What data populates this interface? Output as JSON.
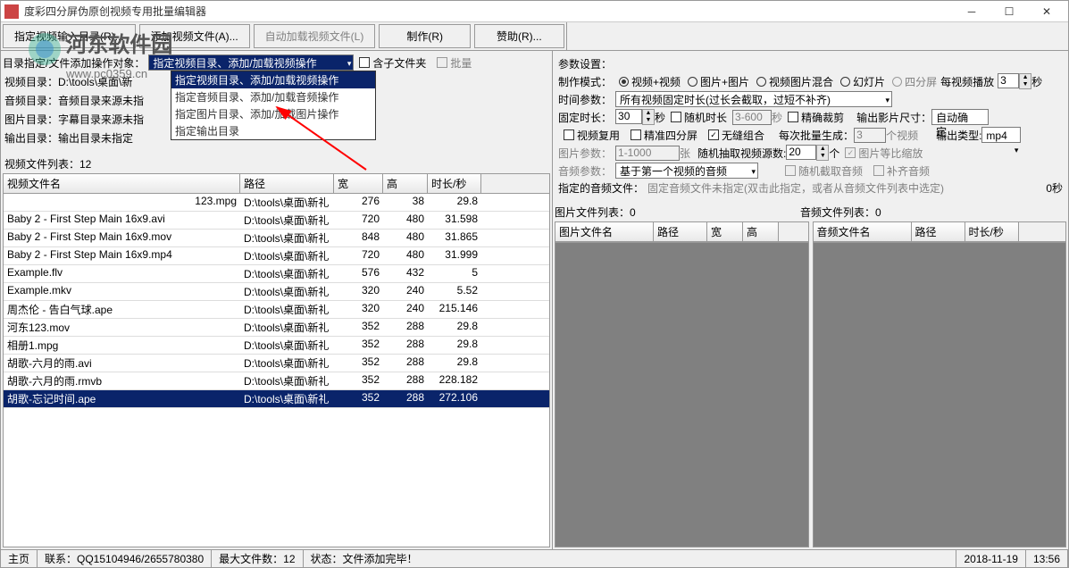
{
  "title": "度彩四分屏伪原创视频专用批量编辑器",
  "toolbar": {
    "btn1": "指定视频输入目录(R)...",
    "btn2": "添加视频文件(A)...",
    "btn3": "自动加载视频文件(L)",
    "btn4": "制作(R)",
    "btn5": "赞助(R)..."
  },
  "left": {
    "combo_label": "目录指定/文件添加操作对象：",
    "combo_value": "指定视频目录、添加/加载视频操作",
    "dd_items": [
      "指定视频目录、添加/加载视频操作",
      "指定音频目录、添加/加载音频操作",
      "指定图片目录、添加/加载图片操作",
      "指定输出目录"
    ],
    "include_sub": "含子文件夹",
    "batch": "批量",
    "dir_video_l": "视频目录：",
    "dir_video_v": "D:\\tools\\桌面\\新",
    "dir_audio_l": "音频目录：",
    "dir_audio_v": "音频目录来源未指",
    "dir_pic_l": "图片目录：",
    "dir_pic_v": "字幕目录来源未指",
    "dir_out_l": "输出目录：",
    "dir_out_v": "输出目录未指定",
    "list_count": "视频文件列表：12",
    "headers": {
      "name": "视频文件名",
      "path": "路径",
      "w": "宽",
      "h": "高",
      "dur": "时长/秒"
    },
    "rows": [
      {
        "name": "123.mpg",
        "path": "D:\\tools\\桌面\\新礼",
        "w": "276",
        "h": "38",
        "dur": "29.8"
      },
      {
        "name": "Baby 2 - First Step Main 16x9.avi",
        "path": "D:\\tools\\桌面\\新礼",
        "w": "720",
        "h": "480",
        "dur": "31.598"
      },
      {
        "name": "Baby 2 - First Step Main 16x9.mov",
        "path": "D:\\tools\\桌面\\新礼",
        "w": "848",
        "h": "480",
        "dur": "31.865"
      },
      {
        "name": "Baby 2 - First Step Main 16x9.mp4",
        "path": "D:\\tools\\桌面\\新礼",
        "w": "720",
        "h": "480",
        "dur": "31.999"
      },
      {
        "name": "Example.flv",
        "path": "D:\\tools\\桌面\\新礼",
        "w": "576",
        "h": "432",
        "dur": "5"
      },
      {
        "name": "Example.mkv",
        "path": "D:\\tools\\桌面\\新礼",
        "w": "320",
        "h": "240",
        "dur": "5.52"
      },
      {
        "name": "周杰伦 - 告白气球.ape",
        "path": "D:\\tools\\桌面\\新礼",
        "w": "320",
        "h": "240",
        "dur": "215.146"
      },
      {
        "name": "河东123.mov",
        "path": "D:\\tools\\桌面\\新礼",
        "w": "352",
        "h": "288",
        "dur": "29.8"
      },
      {
        "name": "相册1.mpg",
        "path": "D:\\tools\\桌面\\新礼",
        "w": "352",
        "h": "288",
        "dur": "29.8"
      },
      {
        "name": "胡歌-六月的雨.avi",
        "path": "D:\\tools\\桌面\\新礼",
        "w": "352",
        "h": "288",
        "dur": "29.8"
      },
      {
        "name": "胡歌-六月的雨.rmvb",
        "path": "D:\\tools\\桌面\\新礼",
        "w": "352",
        "h": "288",
        "dur": "228.182"
      },
      {
        "name": "胡歌-忘记时间.ape",
        "path": "D:\\tools\\桌面\\新礼",
        "w": "352",
        "h": "288",
        "dur": "272.106",
        "sel": true
      }
    ]
  },
  "right": {
    "param_title": "参数设置：",
    "mode_label": "制作模式：",
    "mode_vv": "视频+视频",
    "mode_pp": "图片+图片",
    "mode_vp": "视频图片混合",
    "mode_slide": "幻灯片",
    "mode_quad": "四分屏",
    "per_play": "每视频播放",
    "per_play_val": "3",
    "second": "秒",
    "time_label": "时间参数：",
    "time_combo": "所有视频固定时长(过长会截取，过短不补齐)",
    "fixed_dur": "固定时长：",
    "fixed_dur_val": "30",
    "rand_dur": "随机时长",
    "rand_dur_val": "3-600",
    "precise_cut": "精确裁剪",
    "out_size": "输出影片尺寸：",
    "out_size_val": "自动确定",
    "reuse": "视频复用",
    "precise_quad": "精准四分屏",
    "seamless": "无缝组合",
    "batch_gen": "每次批量生成：",
    "batch_gen_val": "3",
    "video_unit": "个视频",
    "out_type": "输出类型:",
    "out_type_val": "mp4",
    "pic_param": "图片参数：",
    "pic_param_val": "1-1000",
    "pic_unit": "张",
    "rand_pick": "随机抽取视频源数:",
    "rand_pick_val": "20",
    "count_unit": "个",
    "scale_pic": "图片等比缩放",
    "audio_param": "音频参数：",
    "audio_combo": "基于第一个视频的音频",
    "rand_audio": "随机截取音频",
    "fill_audio": "补齐音频",
    "audio_file": "指定的音频文件：",
    "audio_file_val": "固定音频文件未指定(双击此指定，或者从音频文件列表中选定)",
    "zero_sec": "0秒",
    "pic_list": "图片文件列表：0",
    "audio_list": "音频文件列表：0",
    "headers_pic": {
      "name": "图片文件名",
      "path": "路径",
      "w": "宽",
      "h": "高"
    },
    "headers_audio": {
      "name": "音频文件名",
      "path": "路径",
      "dur": "时长/秒"
    }
  },
  "status": {
    "main": "主页",
    "contact": "联系：QQ15104946/2655780380",
    "maxfiles": "最大文件数：12",
    "state": "状态：文件添加完毕！",
    "date": "2018-11-19",
    "time": "13:56"
  },
  "watermark": {
    "text": "河东软件园",
    "url": "www.pc0359.cn"
  }
}
